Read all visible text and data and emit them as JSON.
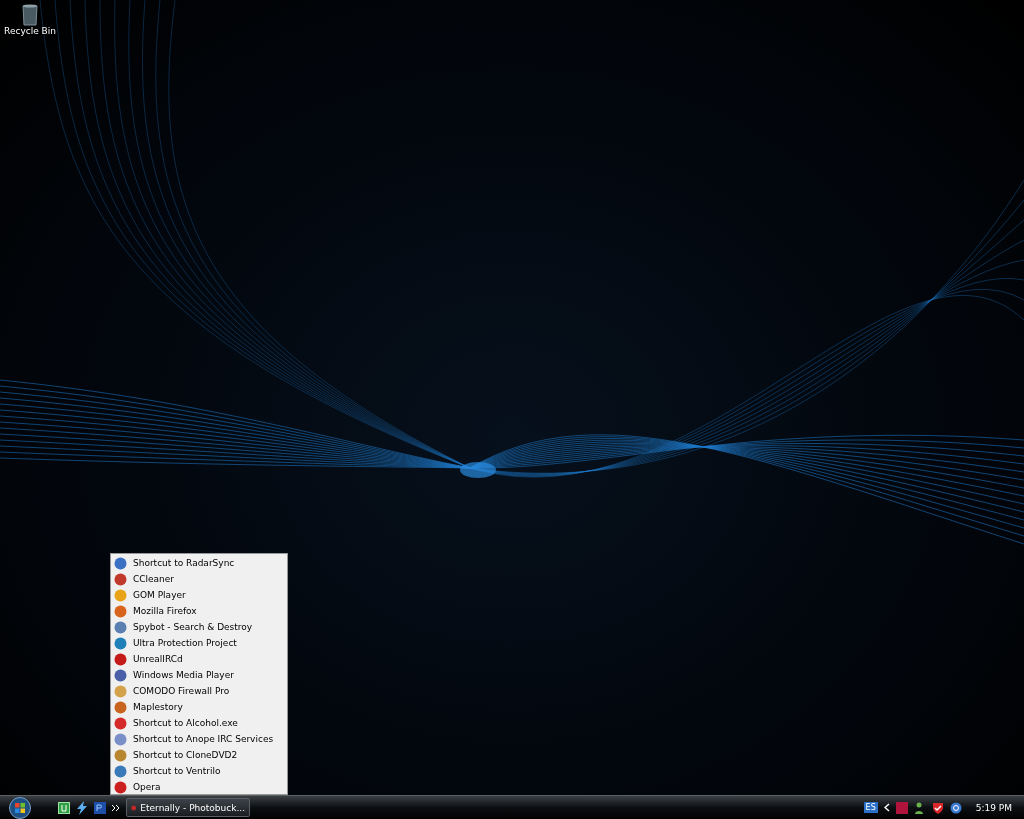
{
  "desktop_icons": [
    {
      "label": "Recycle Bin"
    }
  ],
  "menu": {
    "items": [
      {
        "label": "Shortcut to RadarSync",
        "color": "#3a6fc4"
      },
      {
        "label": "CCleaner",
        "color": "#c0392b"
      },
      {
        "label": "GOM Player",
        "color": "#e8a317"
      },
      {
        "label": "Mozilla Firefox",
        "color": "#d9641e"
      },
      {
        "label": "Spybot - Search & Destroy",
        "color": "#5b7fb0"
      },
      {
        "label": "Ultra Protection Project",
        "color": "#1f7fb8"
      },
      {
        "label": "UnrealIRCd",
        "color": "#c41a1a"
      },
      {
        "label": "Windows Media Player",
        "color": "#4a5fa8"
      },
      {
        "label": "COMODO Firewall Pro",
        "color": "#d4a24a"
      },
      {
        "label": "Maplestory",
        "color": "#c8641e"
      },
      {
        "label": "Shortcut to Alcohol.exe",
        "color": "#d42a2a"
      },
      {
        "label": "Shortcut to Anope IRC Services",
        "color": "#7a8fc8"
      },
      {
        "label": "Shortcut to CloneDVD2",
        "color": "#b8862e"
      },
      {
        "label": "Shortcut to Ventrilo",
        "color": "#3a7ab8"
      },
      {
        "label": "Opera",
        "color": "#cc1f1f"
      }
    ]
  },
  "taskbar": {
    "tasks": [
      {
        "label": "Eternally - Photobuck..."
      }
    ],
    "tray": {
      "language": "ES",
      "clock": "5:19 PM"
    }
  }
}
